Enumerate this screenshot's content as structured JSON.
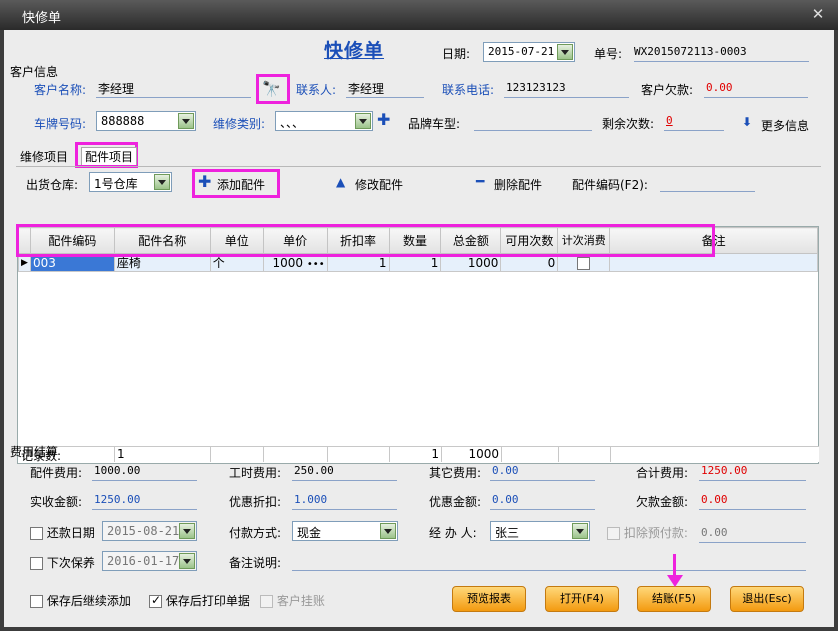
{
  "window": {
    "title": "快修单",
    "close_glyph": "✕"
  },
  "header": {
    "form_title": "快修单",
    "date_label": "日期:",
    "date_value": "2015-07-21",
    "order_no_label": "单号:",
    "order_no_value": "WX2015072113-0003"
  },
  "customer": {
    "section_label": "客户信息",
    "name_label": "客户名称:",
    "name_value": "李经理",
    "contact_label": "联系人:",
    "contact_value": "李经理",
    "phone_label": "联系电话:",
    "phone_value": "123123123",
    "debt_label": "客户欠款:",
    "debt_value": "0.00",
    "plate_label": "车牌号码:",
    "plate_value": "888888",
    "repair_type_label": "维修类别:",
    "repair_type_value": "、、、",
    "brand_label": "品牌车型:",
    "brand_value": "",
    "remaining_label": "剩余次数:",
    "remaining_value": "0",
    "more_label": "更多信息"
  },
  "tabs": [
    {
      "label": "维修项目"
    },
    {
      "label": "配件项目"
    }
  ],
  "parts_toolbar": {
    "warehouse_label": "出货仓库:",
    "warehouse_value": "1号仓库",
    "add_label": "添加配件",
    "edit_label": "修改配件",
    "delete_label": "删除配件",
    "code_label": "配件编码(F2):"
  },
  "table": {
    "columns": [
      "配件编码",
      "配件名称",
      "单位",
      "单价",
      "折扣率",
      "数量",
      "总金额",
      "可用次数",
      "计次消费",
      "备注"
    ],
    "rows": [
      {
        "code": "003",
        "name": "座椅",
        "unit": "个",
        "price": "1000",
        "discount": "1",
        "qty": "1",
        "total": "1000",
        "avail": "0",
        "count_consume": false,
        "remark": ""
      }
    ],
    "footer": {
      "label": "记录数:",
      "count": "1",
      "qty_sum": "1",
      "total_sum": "1000"
    }
  },
  "fees": {
    "section_label": "费用结算",
    "parts_fee_label": "配件费用:",
    "parts_fee_value": "1000.00",
    "labor_fee_label": "工时费用:",
    "labor_fee_value": "250.00",
    "other_fee_label": "其它费用:",
    "other_fee_value": "0.00",
    "total_label": "合计费用:",
    "total_value": "1250.00",
    "paid_label": "实收金额:",
    "paid_value": "1250.00",
    "discount_label": "优惠折扣:",
    "discount_value": "1.000",
    "discount_amt_label": "优惠金额:",
    "discount_amt_value": "0.00",
    "owe_label": "欠款金额:",
    "owe_value": "0.00",
    "repay_date_label": "还款日期",
    "repay_date_value": "2015-08-21",
    "pay_method_label": "付款方式:",
    "pay_method_value": "现金",
    "handler_label": "经 办 人:",
    "handler_value": "张三",
    "deduct_prepay_label": "扣除预付款:",
    "deduct_prepay_value": "0.00",
    "next_maint_label": "下次保养",
    "next_maint_value": "2016-01-17",
    "remark_label": "备注说明:",
    "remark_value": ""
  },
  "bottom": {
    "keep_adding_label": "保存后继续添加",
    "print_after_save_label": "保存后打印单据",
    "customer_credit_label": "客户挂账",
    "preview_btn": "预览报表",
    "open_btn": "打开(F4)",
    "checkout_btn": "结账(F5)",
    "exit_btn": "退出(Esc)"
  },
  "colors": {
    "accent_blue": "#1b4fb8",
    "highlight": "#ee22dd",
    "button_orange": "#f39a10"
  }
}
